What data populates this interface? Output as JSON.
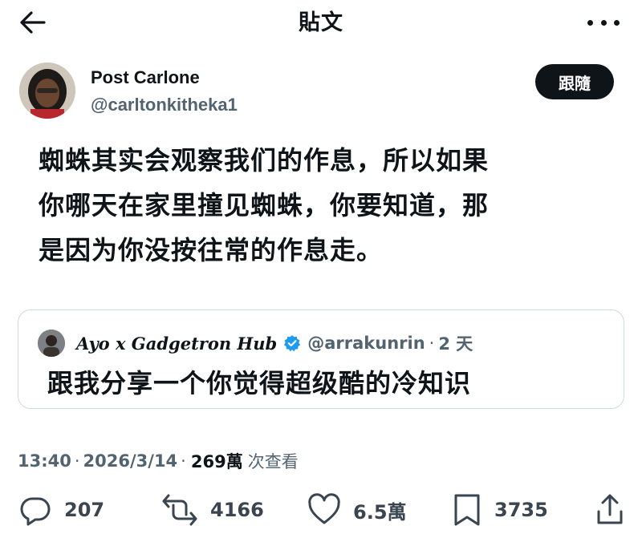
{
  "header": {
    "title": "貼文",
    "back_icon": "arrow-left-icon",
    "more_icon": "more-horizontal-icon"
  },
  "author": {
    "name": "Post Carlone",
    "handle": "@carltonkitheka1",
    "follow_label": "跟隨"
  },
  "post": {
    "lines": [
      "蜘蛛其实会观察我们的作息，所以如果",
      "你哪天在家里撞见蜘蛛，你要知道，那",
      "是因为你没按往常的作息走。"
    ]
  },
  "quote": {
    "name": "Ayo x Gadgetron Hub",
    "handle": "@arrakunrin",
    "separator": "·",
    "time": "2 天",
    "text": "跟我分享一个你觉得超级酷的冷知识"
  },
  "meta": {
    "time": "13:40",
    "sep1": "·",
    "date": "2026/3/14",
    "sep2": "·",
    "views": "269萬",
    "views_label": "次查看"
  },
  "actions": {
    "replies": "207",
    "reposts": "4166",
    "likes": "6.5萬",
    "bookmarks": "3735"
  },
  "colors": {
    "text": "#0f1419",
    "secondary": "#536471",
    "border": "#cfd9de",
    "verified": "#1d9bf0"
  }
}
